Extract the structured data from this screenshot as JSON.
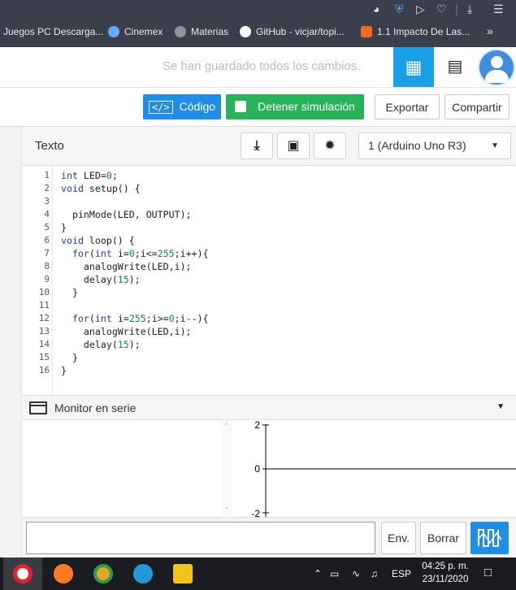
{
  "browser": {
    "bookmarks": [
      {
        "label": "Juegos PC Descarga...",
        "color": ""
      },
      {
        "label": "Cinemex",
        "color": "#6aa7ff"
      },
      {
        "label": "Materias",
        "color": "#8d95a3"
      },
      {
        "label": "GitHub - vicjar/topi...",
        "color": "#ffffff"
      },
      {
        "label": "1.1 Impacto De Las...",
        "color": "#f26b1d"
      }
    ],
    "more_label": "»"
  },
  "app": {
    "save_status": "Se han guardado todos los cambios.",
    "toolbar": {
      "code_label": "Código",
      "stop_label": "Detener simulación",
      "export_label": "Exportar",
      "share_label": "Compartir"
    },
    "editor": {
      "mode_label": "Texto",
      "device_select": "1 (Arduino Uno R3)",
      "lines": [
        "int LED=0;",
        "void setup() {",
        "",
        "  pinMode(LED, OUTPUT);",
        "}",
        "void loop() {",
        "  for(int i=0;i<=255;i++){",
        "    analogWrite(LED,i);",
        "    delay(15);",
        "  }",
        "",
        "  for(int i=255;i>=0;i--){",
        "    analogWrite(LED,i);",
        "    delay(15);",
        "  }",
        "}"
      ]
    },
    "serial_monitor": {
      "label": "Monitor en serie",
      "input_value": "",
      "send_label": "Env.",
      "clear_label": "Borrar",
      "plot_ticks": [
        "2",
        "0",
        "-2"
      ]
    }
  },
  "taskbar": {
    "language": "ESP",
    "time": "04:25 p. m.",
    "date": "23/11/2020"
  }
}
